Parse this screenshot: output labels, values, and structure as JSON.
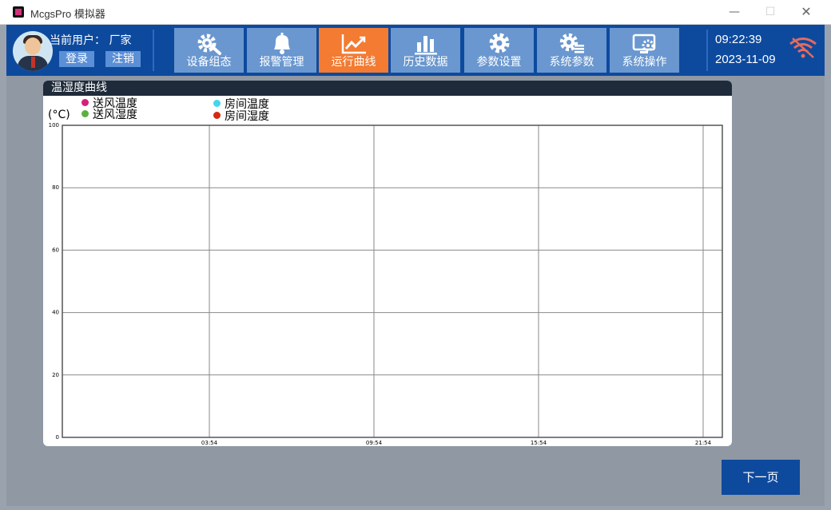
{
  "window": {
    "title": "McgsPro 模拟器",
    "minimize": "—",
    "maximize": "☐",
    "close": "✕"
  },
  "header": {
    "user_label": "当前用户：  厂家",
    "login": "登录",
    "logout": "注销",
    "nav": [
      {
        "label": "设备组态",
        "icon": "gear-wrench-icon",
        "active": false
      },
      {
        "label": "报警管理",
        "icon": "bell-icon",
        "active": false
      },
      {
        "label": "运行曲线",
        "icon": "line-chart-icon",
        "active": true
      },
      {
        "label": "历史数据",
        "icon": "bar-chart-icon",
        "active": false
      },
      {
        "label": "参数设置",
        "icon": "gear-icon",
        "active": false
      },
      {
        "label": "系统参数",
        "icon": "gear-list-icon",
        "active": false
      },
      {
        "label": "系统操作",
        "icon": "monitor-gear-icon",
        "active": false
      }
    ],
    "time": "09:22:39",
    "date": "2023-11-09",
    "wifi_icon": "wifi-off-icon"
  },
  "panel": {
    "title": "温湿度曲线",
    "unit": "(°C)",
    "legend": [
      {
        "label": "送风温度",
        "color": "#d6207a"
      },
      {
        "label": "送风湿度",
        "color": "#5cb040"
      },
      {
        "label": "房间温度",
        "color": "#3fd8f0"
      },
      {
        "label": "房间湿度",
        "color": "#d42a12"
      }
    ]
  },
  "chart_data": {
    "type": "line",
    "ylim": [
      0,
      100
    ],
    "y_ticks": [
      "0",
      "20",
      "40",
      "60",
      "80",
      "100"
    ],
    "x_ticks": [
      "03:54",
      "09:54",
      "15:54",
      "21:54"
    ],
    "series": [
      {
        "name": "送风温度",
        "color": "#d6207a",
        "values": []
      },
      {
        "name": "送风湿度",
        "color": "#5cb040",
        "values": []
      },
      {
        "name": "房间温度",
        "color": "#3fd8f0",
        "values": []
      },
      {
        "name": "房间湿度",
        "color": "#d42a12",
        "values": []
      }
    ],
    "grid": true
  },
  "footer": {
    "next_page": "下一页"
  }
}
